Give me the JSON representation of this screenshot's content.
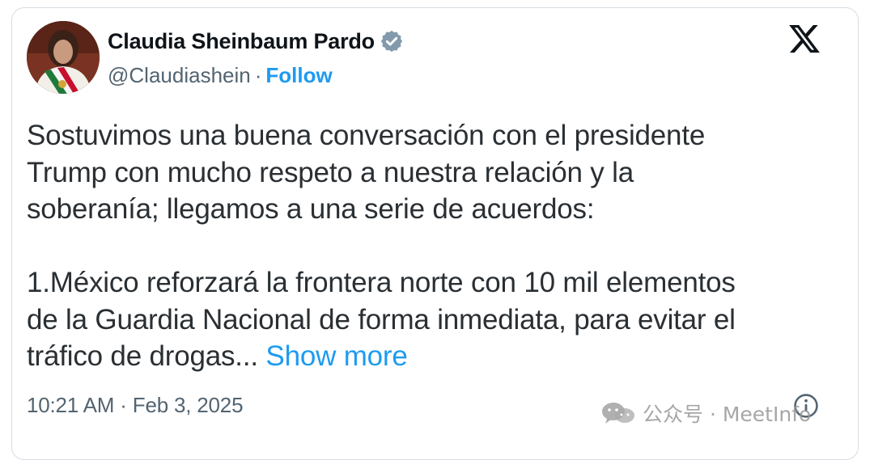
{
  "tweet": {
    "author_name": "Claudia Sheinbaum Pardo",
    "handle": "@Claudiashein",
    "separator": "·",
    "follow_label": "Follow",
    "paragraphs": [
      [
        "Sostuvimos una buena conversación con el presidente",
        "Trump con mucho respeto a nuestra relación y la",
        "soberanía; llegamos a una serie de acuerdos:"
      ],
      [
        "1.México reforzará la frontera norte con 10 mil elementos",
        "de la Guardia Nacional de forma inmediata, para evitar el",
        "tráfico de drogas..."
      ]
    ],
    "show_more_label": "Show more",
    "timestamp": "10:21 AM · Feb 3, 2025"
  },
  "icons": {
    "verified": "verified-badge-icon",
    "platform_logo": "x-logo-icon",
    "info": "info-icon"
  },
  "watermark": {
    "text": "公众号 · MeetInfo"
  },
  "colors": {
    "link": "#1d9bf0",
    "text_primary": "#0f1419",
    "text_secondary": "#536471",
    "border": "#d6dde3"
  }
}
